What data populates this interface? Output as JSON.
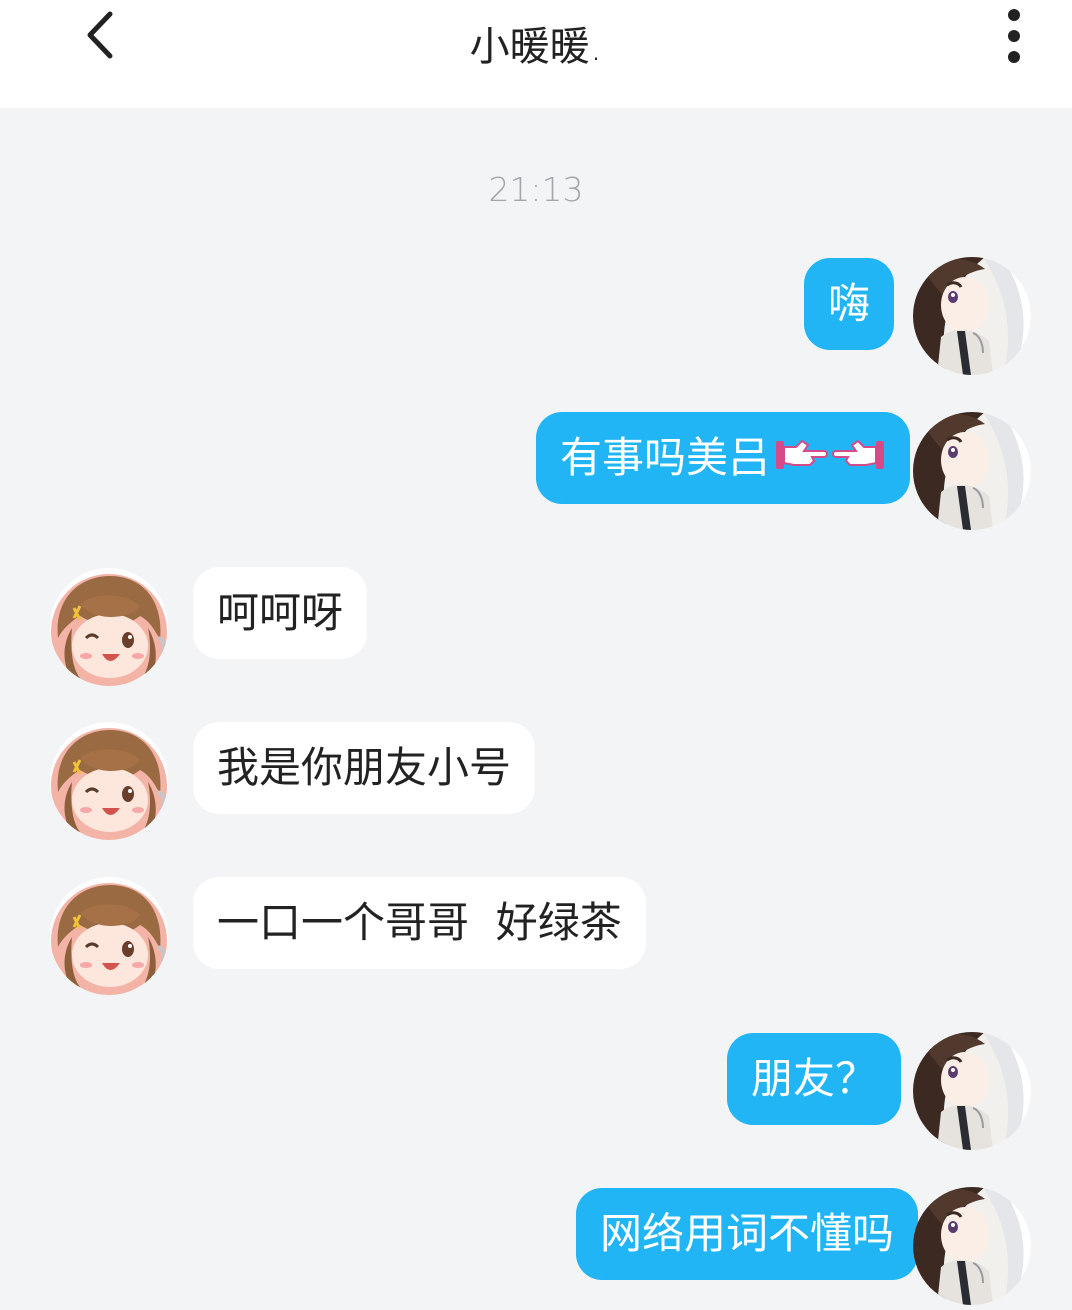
{
  "header": {
    "title": "小暖暖.",
    "back_icon": "chevron-left-icon",
    "menu_icon": "more-vertical-icon"
  },
  "time": "21:13",
  "colors": {
    "accent": "#21b5f5",
    "background": "#f3f4f6",
    "header": "#ffffff"
  },
  "messages": [
    {
      "from": "me",
      "text": "嗨"
    },
    {
      "from": "me",
      "text": "有事吗美吕",
      "emoji": "pointing-hands-icon"
    },
    {
      "from": "other",
      "text": "呵呵呀"
    },
    {
      "from": "other",
      "text": "我是你朋友小号"
    },
    {
      "from": "other",
      "text": "一口一个哥哥  好绿茶"
    },
    {
      "from": "me",
      "text": "朋友？"
    },
    {
      "from": "me",
      "text": "网络用词不懂吗"
    }
  ]
}
